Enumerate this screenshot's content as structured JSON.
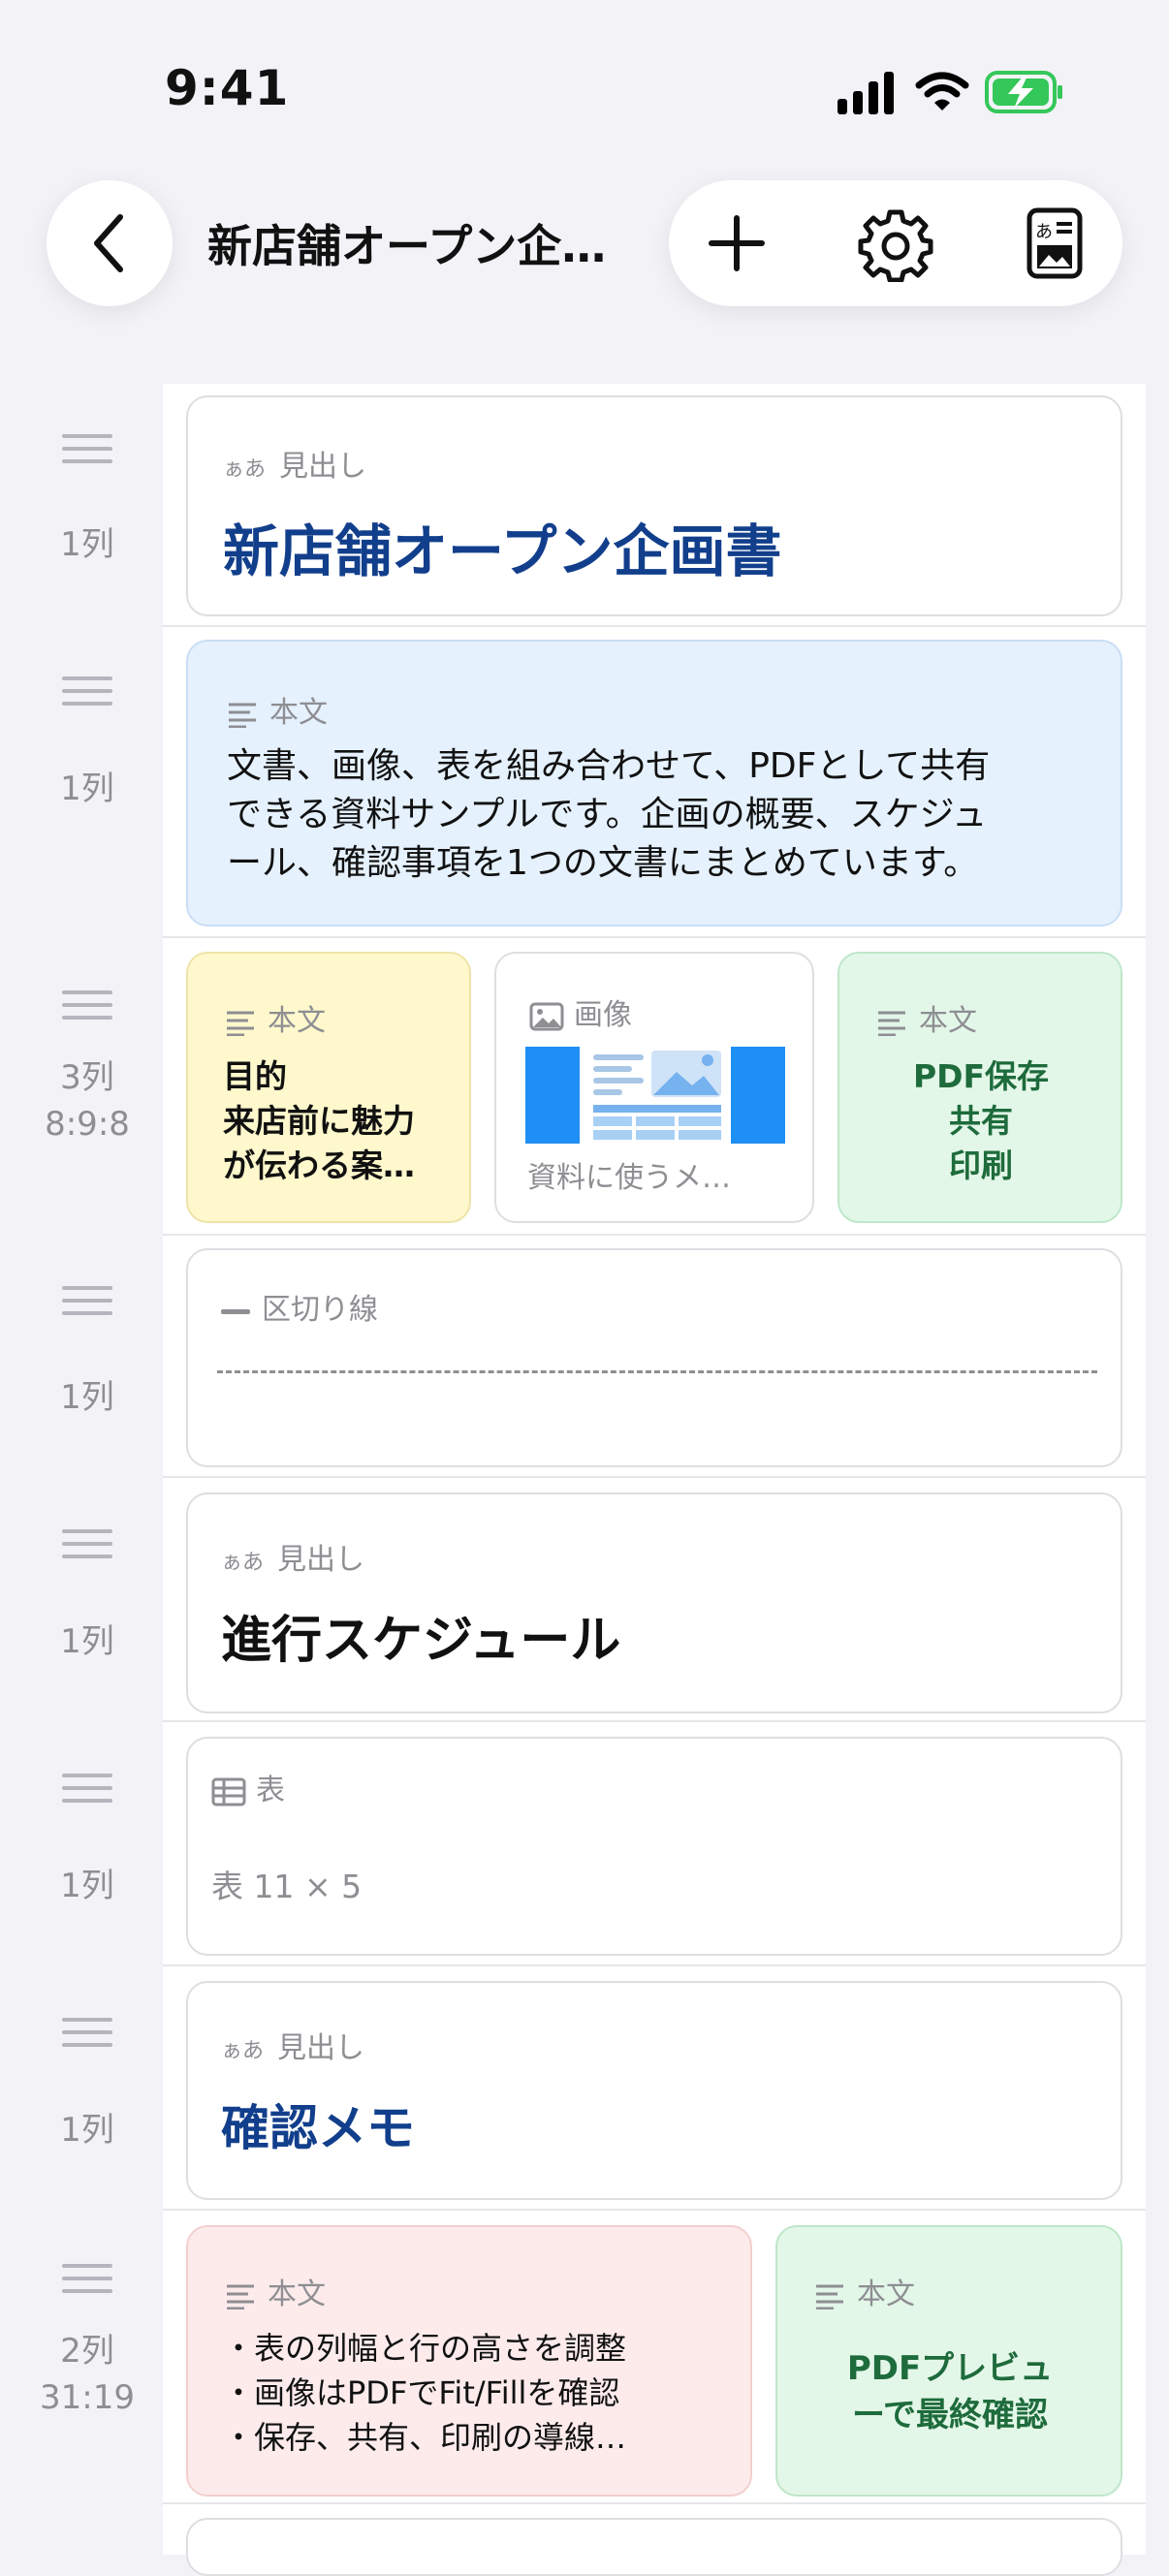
{
  "status": {
    "time": "9:41"
  },
  "nav": {
    "title": "新店舗オープン企画書"
  },
  "rows": [
    {
      "handle": "1列",
      "card": {
        "type": "見出し",
        "aa": "ぁあ",
        "text": "新店舗オープン企画書"
      }
    },
    {
      "handle": "1列",
      "card": {
        "type": "本文",
        "lines": [
          "文書、画像、表を組み合わせて、PDFとして共有",
          "できる資料サンプルです。企画の概要、スケジュ",
          "ール、確認事項を1つの文書にまとめています。"
        ]
      }
    },
    {
      "handle": "3列",
      "ratio": "8:9:8",
      "cards": [
        {
          "type": "本文",
          "lines": [
            "目的",
            "来店前に魅力",
            "が伝わる案…"
          ]
        },
        {
          "type": "画像",
          "caption": "資料に使うメ…"
        },
        {
          "type": "本文",
          "lines": [
            "PDF保存",
            "共有",
            "印刷"
          ]
        }
      ]
    },
    {
      "handle": "1列",
      "card": {
        "type": "区切り線"
      }
    },
    {
      "handle": "1列",
      "card": {
        "type": "見出し",
        "aa": "ぁあ",
        "text": "進行スケジュール"
      }
    },
    {
      "handle": "1列",
      "card": {
        "type": "表",
        "text": "表 11 × 5"
      }
    },
    {
      "handle": "1列",
      "card": {
        "type": "見出し",
        "aa": "ぁあ",
        "text": "確認メモ"
      }
    },
    {
      "handle": "2列",
      "ratio": "31:19",
      "cards": [
        {
          "type": "本文",
          "lines": [
            "・表の列幅と行の高さを調整",
            "・画像はPDFでFit/Fillを確認",
            "・保存、共有、印刷の導線…"
          ]
        },
        {
          "type": "本文",
          "lines": [
            "PDFプレビュ",
            "ーで最終確認"
          ]
        }
      ]
    }
  ],
  "colors": {
    "blue_card": "#e5f1fd",
    "yellow_card": "#fff8cc",
    "green_card": "#e3f7e8",
    "red_card": "#fdebeb",
    "heading_blue": "#123f8c",
    "green_text": "#1e6b3c"
  }
}
